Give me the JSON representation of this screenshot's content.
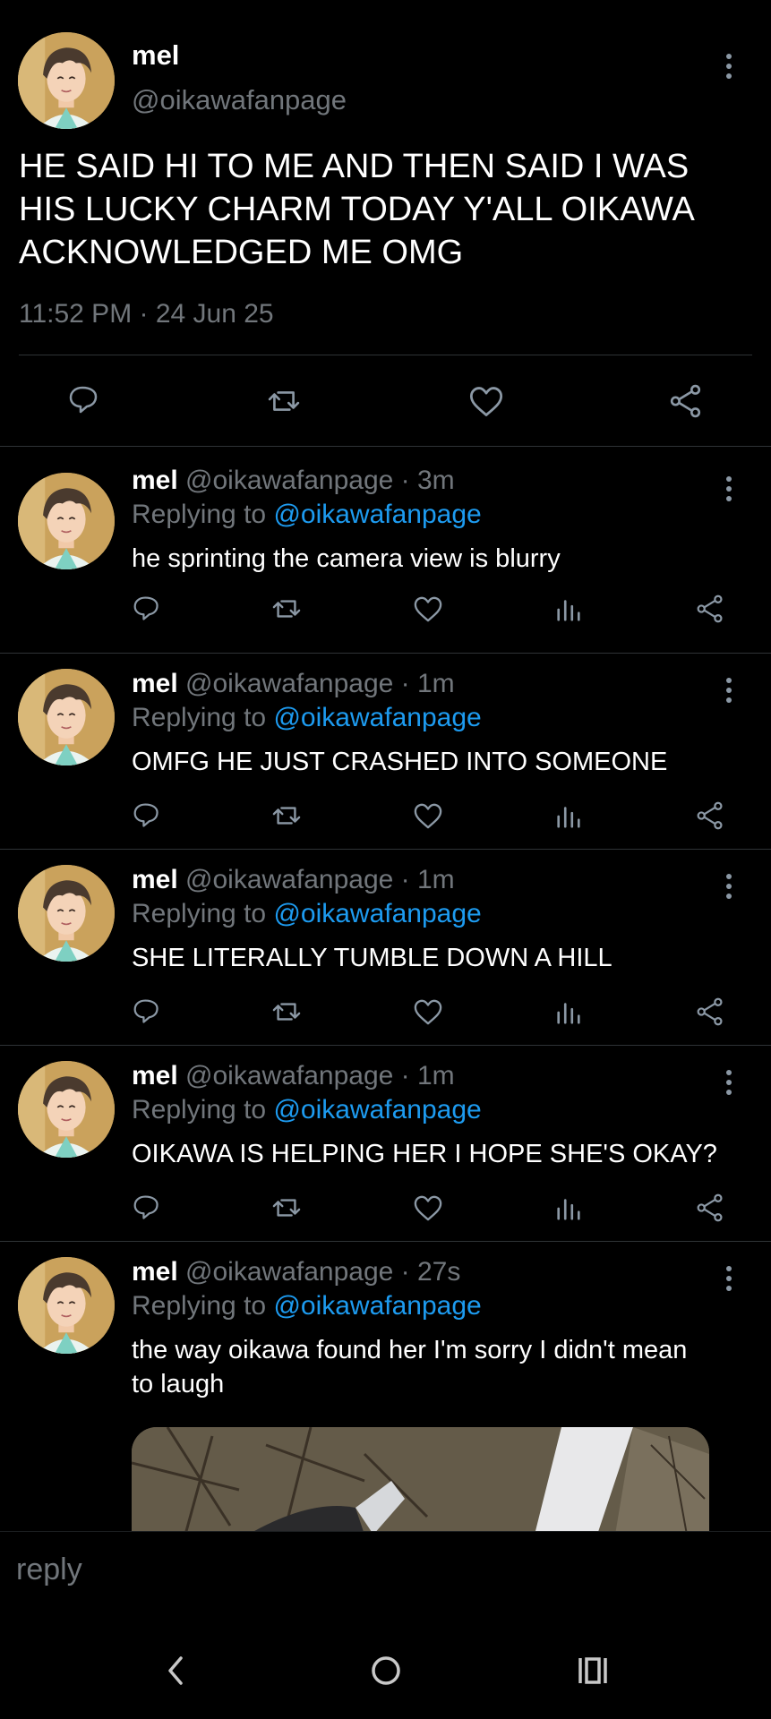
{
  "main_tweet": {
    "name": "mel",
    "handle": "@oikawafanpage",
    "text": "HE SAID HI TO ME AND THEN SAID I WAS HIS LUCKY CHARM TODAY Y'ALL OIKAWA ACKNOWLEDGED ME OMG",
    "timestamp": "11:52 PM · 24 Jun 25",
    "actions": [
      "reply-icon",
      "retweet-icon",
      "like-icon",
      "share-icon"
    ]
  },
  "replies": [
    {
      "name": "mel",
      "handle": "@oikawafanpage",
      "time": "· 3m",
      "replying_prefix": "Replying to ",
      "replying_to": "@oikawafanpage",
      "text": "he sprinting the camera view is blurry"
    },
    {
      "name": "mel",
      "handle": "@oikawafanpage",
      "time": "· 1m",
      "replying_prefix": "Replying to ",
      "replying_to": "@oikawafanpage",
      "text": "OMFG HE JUST CRASHED INTO SOMEONE"
    },
    {
      "name": "mel",
      "handle": "@oikawafanpage",
      "time": "· 1m",
      "replying_prefix": "Replying to ",
      "replying_to": "@oikawafanpage",
      "text": "SHE LITERALLY TUMBLE DOWN A HILL"
    },
    {
      "name": "mel",
      "handle": "@oikawafanpage",
      "time": "· 1m",
      "replying_prefix": "Replying to ",
      "replying_to": "@oikawafanpage",
      "text": "OIKAWA IS HELPING HER I HOPE SHE'S OKAY?"
    },
    {
      "name": "mel",
      "handle": "@oikawafanpage",
      "time": "· 27s",
      "replying_prefix": "Replying to ",
      "replying_to": "@oikawafanpage",
      "text": "the way oikawa found her I'm sorry I didn't mean to laugh"
    }
  ],
  "reply_bar": {
    "placeholder": "reply"
  },
  "nav": [
    "back-icon",
    "home-icon",
    "recents-icon"
  ],
  "colors": {
    "background": "#000000",
    "text": "#e7e9ea",
    "muted": "#71767b",
    "link": "#1d9bf0"
  }
}
